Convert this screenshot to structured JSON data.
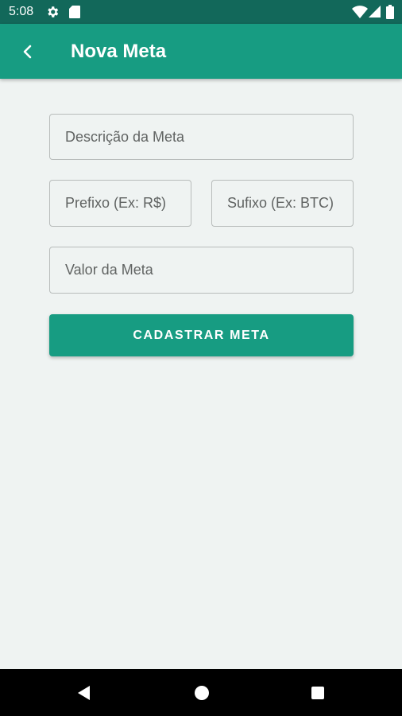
{
  "status_bar": {
    "time": "5:08",
    "icons": [
      "settings-gear-icon",
      "sd-card-icon",
      "wifi-icon",
      "cell-signal-icon",
      "battery-icon"
    ]
  },
  "app_bar": {
    "title": "Nova Meta",
    "back_icon": "chevron-left-icon"
  },
  "form": {
    "description_placeholder": "Descrição da Meta",
    "prefix_placeholder": "Prefixo (Ex: R$)",
    "suffix_placeholder": "Sufixo (Ex: BTC)",
    "value_placeholder": "Valor da Meta",
    "submit_label": "CADASTRAR META"
  },
  "nav_bar": {
    "icons": [
      "back-triangle-icon",
      "home-circle-icon",
      "recents-square-icon"
    ]
  },
  "colors": {
    "status_bar": "#12685a",
    "primary": "#179c82",
    "background": "#eff3f2"
  }
}
